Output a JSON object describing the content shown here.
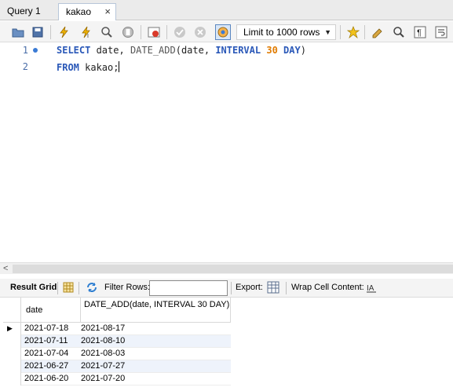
{
  "tabs": [
    {
      "label": "Query 1"
    },
    {
      "label": "kakao",
      "close": "×"
    }
  ],
  "toolbar": {
    "limit_value": "Limit to 1000 rows",
    "icons": [
      "open-folder-icon",
      "save-icon",
      "execute-icon",
      "execute-current-icon",
      "explain-icon",
      "stop-icon",
      "toggle-error-icon",
      "commit-icon",
      "rollback-icon",
      "autocommit-icon",
      "limit-dropdown",
      "add-snippet-icon",
      "beautify-icon",
      "find-icon",
      "invisible-chars-icon",
      "word-wrap-icon"
    ]
  },
  "editor": {
    "lines": [
      {
        "num": "1",
        "parts": [
          {
            "t": "SELECT",
            "c": "kw"
          },
          {
            "t": " date, ",
            "c": ""
          },
          {
            "t": "DATE_ADD",
            "c": "fn"
          },
          {
            "t": "(date, ",
            "c": ""
          },
          {
            "t": "INTERVAL",
            "c": "kw"
          },
          {
            "t": " ",
            "c": ""
          },
          {
            "t": "30",
            "c": "num"
          },
          {
            "t": " ",
            "c": ""
          },
          {
            "t": "DAY",
            "c": "kw"
          },
          {
            "t": ")",
            "c": ""
          }
        ]
      },
      {
        "num": "2",
        "parts": [
          {
            "t": "FROM",
            "c": "kw"
          },
          {
            "t": " kakao;",
            "c": ""
          }
        ]
      }
    ]
  },
  "results_toolbar": {
    "result_grid": "Result Grid",
    "filter_rows": "Filter Rows:",
    "filter_value": "",
    "export": "Export:",
    "wrap_cell": "Wrap Cell Content:"
  },
  "grid": {
    "columns": [
      "date",
      "DATE_ADD(date, INTERVAL 30 DAY)"
    ],
    "rows": [
      [
        "2021-07-18",
        "2021-08-17"
      ],
      [
        "2021-07-11",
        "2021-08-10"
      ],
      [
        "2021-07-04",
        "2021-08-03"
      ],
      [
        "2021-06-27",
        "2021-07-27"
      ],
      [
        "2021-06-20",
        "2021-07-20"
      ]
    ]
  }
}
